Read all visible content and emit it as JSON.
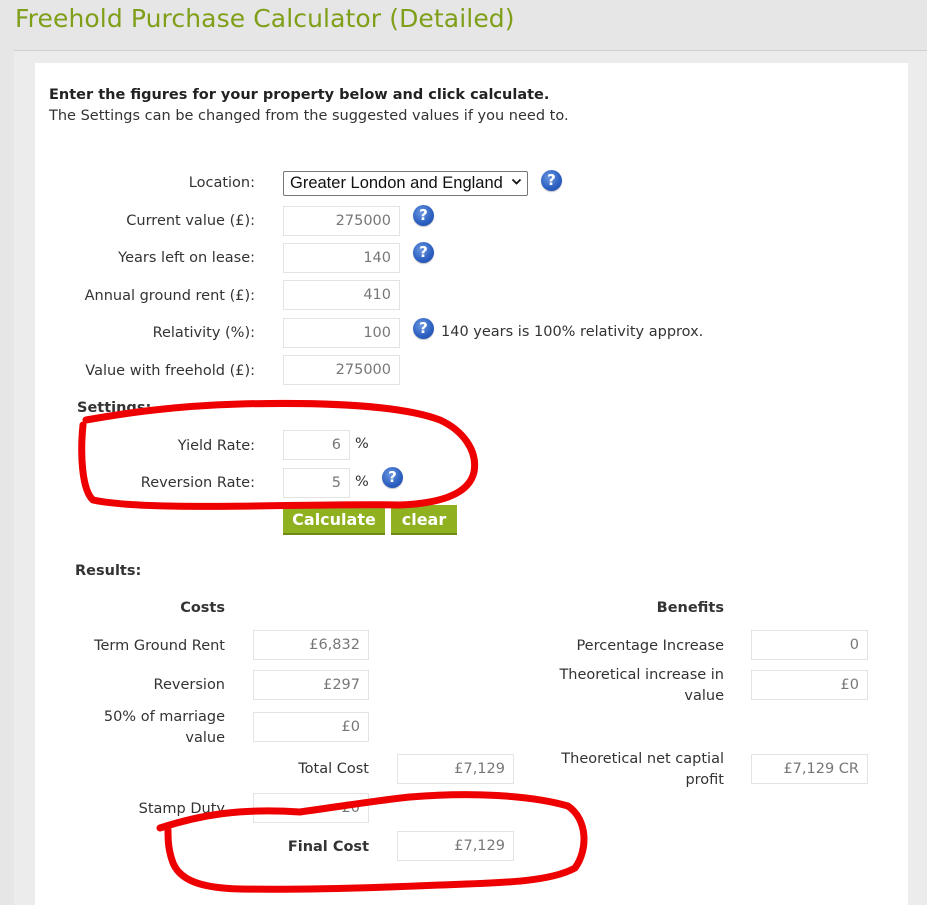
{
  "page": {
    "title": "Freehold Purchase Calculator (Detailed)",
    "intro_strong": "Enter the figures for your property below and click calculate.",
    "intro_text": "The Settings can be changed from the suggested values if you need to."
  },
  "form": {
    "location_label": "Location:",
    "location_value": "Greater London and England",
    "current_value_label": "Current value (£):",
    "current_value": "275000",
    "years_left_label": "Years left on lease:",
    "years_left": "140",
    "ground_rent_label": "Annual ground rent (£):",
    "ground_rent": "410",
    "relativity_label": "Relativity (%):",
    "relativity": "100",
    "relativity_note": "140 years is 100% relativity approx.",
    "value_freehold_label": "Value with freehold (£):",
    "value_freehold": "275000",
    "help_glyph": "?"
  },
  "settings": {
    "heading": "Settings:",
    "yield_label": "Yield Rate:",
    "yield_value": "6",
    "reversion_label": "Reversion Rate:",
    "reversion_value": "5",
    "percent_sign": "%"
  },
  "buttons": {
    "calculate": "Calculate",
    "clear": "clear"
  },
  "results": {
    "heading": "Results:",
    "costs_heading": "Costs",
    "benefits_heading": "Benefits",
    "term_ground_rent_label": "Term Ground Rent",
    "term_ground_rent": "£6,832",
    "reversion_label": "Reversion",
    "reversion": "£297",
    "marriage_label_1": "50% of marriage",
    "marriage_label_2": "value",
    "marriage": "£0",
    "total_cost_label": "Total Cost",
    "total_cost": "£7,129",
    "stamp_duty_label": "Stamp Duty",
    "stamp_duty": "£0",
    "final_cost_label": "Final Cost",
    "final_cost": "£7,129",
    "pct_increase_label": "Percentage Increase",
    "pct_increase": "0",
    "theoretical_increase_label_1": "Theoretical increase in",
    "theoretical_increase_label_2": "value",
    "theoretical_increase": "£0",
    "net_profit_label_1": "Theoretical net captial",
    "net_profit_label_2": "profit",
    "net_profit": "£7,129 CR"
  },
  "colors": {
    "title_green": "#7f9f19",
    "button_green": "#8fb01f",
    "help_blue": "#2a5ec0",
    "annotation_red": "#ee0000"
  },
  "icons": {
    "help": "help-icon",
    "select_chevron": "chevron-down-icon"
  }
}
